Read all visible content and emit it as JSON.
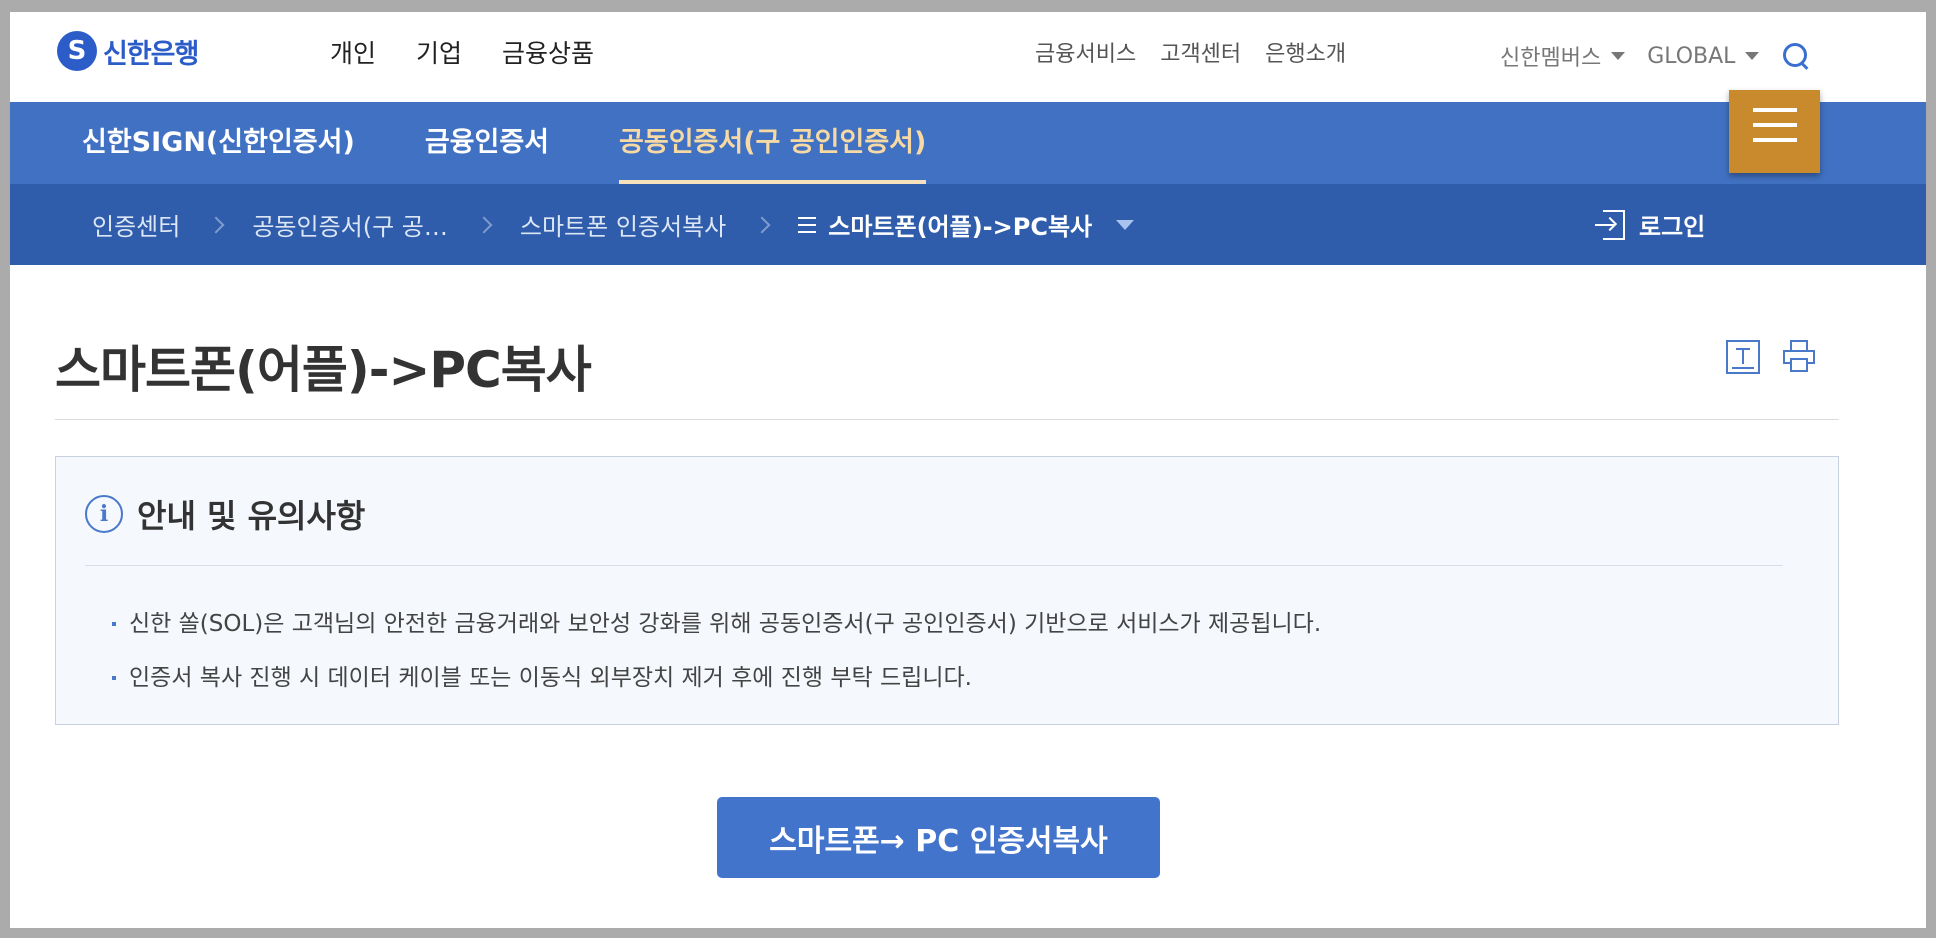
{
  "brand": {
    "mark": "S",
    "name": "신한은행"
  },
  "gnb": {
    "main": [
      "개인",
      "기업",
      "금융상품"
    ],
    "util": [
      "금융서비스",
      "고객센터",
      "은행소개"
    ],
    "members": "신한멤버스",
    "global": "GLOBAL"
  },
  "subnav": {
    "items": [
      "신한SIGN(신한인증서)",
      "금융인증서",
      "공동인증서(구 공인인증서)"
    ],
    "active_index": 2
  },
  "breadcrumb": {
    "items": [
      "인증센터",
      "공동인증서(구 공…",
      "스마트폰 인증서복사"
    ],
    "current": "스마트폰(어플)->PC복사"
  },
  "login": {
    "label": "로그인"
  },
  "page": {
    "title": "스마트폰(어플)->PC복사"
  },
  "notice": {
    "title": "안내 및 유의사항",
    "items": [
      "신한 쏠(SOL)은 고객님의 안전한 금융거래와 보안성 강화를 위해 공동인증서(구 공인인증서) 기반으로 서비스가 제공됩니다.",
      "인증서 복사 진행 시 데이터 케이블 또는 이동식 외부장치 제거 후에 진행 부탁 드립니다."
    ]
  },
  "cta": {
    "label": "스마트폰→ PC 인증서복사"
  },
  "colors": {
    "primary": "#4171c2",
    "nav_dark": "#2f5dab",
    "menu_button": "#c98a2e",
    "active_tab": "#f7d9a3",
    "cta": "#4374cc"
  },
  "icons": [
    "shinhan-logo-icon",
    "chevron-down-icon",
    "search-icon",
    "hamburger-menu-icon",
    "chevron-right-icon",
    "list-icon",
    "login-icon",
    "font-size-icon",
    "print-icon",
    "info-icon"
  ]
}
